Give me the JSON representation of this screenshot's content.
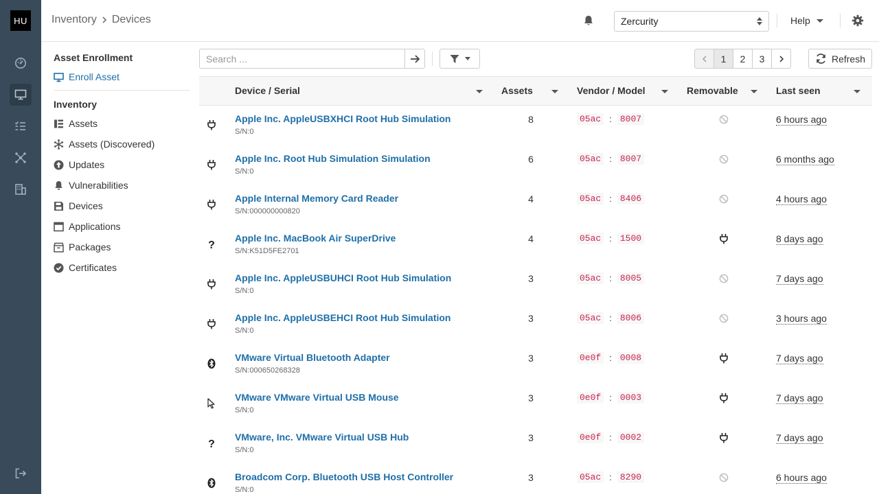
{
  "rail": {
    "logo": "HU",
    "icons": [
      "dashboard-icon",
      "monitor-icon",
      "checklist-icon",
      "network-icon",
      "building-icon"
    ],
    "bottom_icon": "logout-icon"
  },
  "breadcrumb": {
    "root": "Inventory",
    "current": "Devices"
  },
  "header": {
    "tenant": "Zercurity",
    "help": "Help"
  },
  "sidenav": {
    "enrollment_heading": "Asset Enrollment",
    "enroll_asset": "Enroll Asset",
    "inventory_heading": "Inventory",
    "items": [
      {
        "label": "Assets",
        "icon": "list-icon"
      },
      {
        "label": "Assets (Discovered)",
        "icon": "snowflake-icon"
      },
      {
        "label": "Updates",
        "icon": "arrow-up-circle-icon"
      },
      {
        "label": "Vulnerabilities",
        "icon": "bell-icon"
      },
      {
        "label": "Devices",
        "icon": "floppy-icon"
      },
      {
        "label": "Applications",
        "icon": "window-icon"
      },
      {
        "label": "Packages",
        "icon": "box-icon"
      },
      {
        "label": "Certificates",
        "icon": "check-badge-icon"
      }
    ]
  },
  "toolbar": {
    "search_placeholder": "Search ...",
    "pages": [
      "1",
      "2",
      "3"
    ],
    "current_page": "1",
    "refresh": "Refresh"
  },
  "table": {
    "columns": {
      "device": "Device / Serial",
      "assets": "Assets",
      "vendor_model": "Vendor / Model",
      "removable": "Removable",
      "last_seen": "Last seen"
    },
    "rows": [
      {
        "icon": "plug",
        "name": "Apple Inc. AppleUSBXHCI Root Hub Simulation",
        "serial": "S/N:0",
        "assets": "8",
        "vendor": "05ac",
        "model": "8007",
        "removable": false,
        "last_seen": "6 hours ago"
      },
      {
        "icon": "plug",
        "name": "Apple Inc. Root Hub Simulation Simulation",
        "serial": "S/N:0",
        "assets": "6",
        "vendor": "05ac",
        "model": "8007",
        "removable": false,
        "last_seen": "6 months ago"
      },
      {
        "icon": "plug",
        "name": "Apple Internal Memory Card Reader",
        "serial": "S/N:000000000820",
        "assets": "4",
        "vendor": "05ac",
        "model": "8406",
        "removable": false,
        "last_seen": "4 hours ago"
      },
      {
        "icon": "question",
        "name": "Apple Inc. MacBook Air SuperDrive",
        "serial": "S/N:K51D5FE2701",
        "assets": "4",
        "vendor": "05ac",
        "model": "1500",
        "removable": true,
        "last_seen": "8 days ago"
      },
      {
        "icon": "plug",
        "name": "Apple Inc. AppleUSBUHCI Root Hub Simulation",
        "serial": "S/N:0",
        "assets": "3",
        "vendor": "05ac",
        "model": "8005",
        "removable": false,
        "last_seen": "7 days ago"
      },
      {
        "icon": "plug",
        "name": "Apple Inc. AppleUSBEHCI Root Hub Simulation",
        "serial": "S/N:0",
        "assets": "3",
        "vendor": "05ac",
        "model": "8006",
        "removable": false,
        "last_seen": "3 hours ago"
      },
      {
        "icon": "bluetooth",
        "name": "VMware Virtual Bluetooth Adapter",
        "serial": "S/N:000650268328",
        "assets": "3",
        "vendor": "0e0f",
        "model": "0008",
        "removable": true,
        "last_seen": "7 days ago"
      },
      {
        "icon": "pointer",
        "name": "VMware VMware Virtual USB Mouse",
        "serial": "S/N:0",
        "assets": "3",
        "vendor": "0e0f",
        "model": "0003",
        "removable": true,
        "last_seen": "7 days ago"
      },
      {
        "icon": "question",
        "name": "VMware, Inc. VMware Virtual USB Hub",
        "serial": "S/N:0",
        "assets": "3",
        "vendor": "0e0f",
        "model": "0002",
        "removable": true,
        "last_seen": "7 days ago"
      },
      {
        "icon": "bluetooth",
        "name": "Broadcom Corp. Bluetooth USB Host Controller",
        "serial": "S/N:0",
        "assets": "3",
        "vendor": "05ac",
        "model": "8290",
        "removable": false,
        "last_seen": "6 hours ago"
      }
    ]
  },
  "colors": {
    "rail_bg": "#394b5a",
    "link": "#1f6fa8",
    "code": "#c7254e"
  }
}
